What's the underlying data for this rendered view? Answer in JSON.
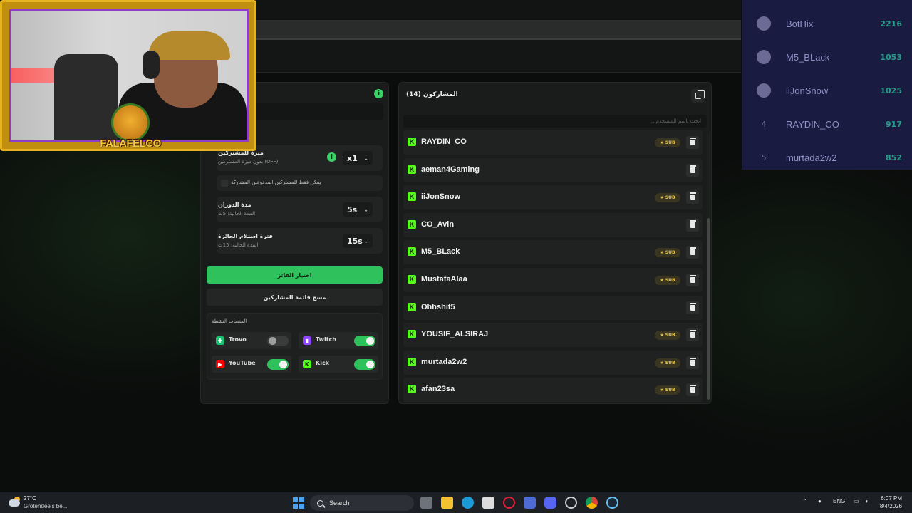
{
  "leaderboard": [
    {
      "rank": "",
      "name": "BotHix",
      "score": "2216",
      "avatar": true
    },
    {
      "rank": "",
      "name": "M5_BLack",
      "score": "1053",
      "avatar": true
    },
    {
      "rank": "",
      "name": "iiJonSnow",
      "score": "1025",
      "avatar": true
    },
    {
      "rank": "4",
      "name": "RAYDIN_CO",
      "score": "917",
      "avatar": false
    },
    {
      "rank": "5",
      "name": "murtada2w2",
      "score": "852",
      "avatar": false
    }
  ],
  "overlay": {
    "logo_text": "FALAFELCO"
  },
  "settings": {
    "viewer_feature_title": "ميزة للمشتركين",
    "viewer_feature_sub": "بدون ميزة المشتركين (OFF)",
    "multiplier": "x1",
    "paid_only_label": "يمكن فقط للمشتركين المدفوعين المشاركة",
    "spin_duration_title": "مدة الدوران",
    "spin_duration_sub": "المدة الحالية: 5ث",
    "spin_duration_value": "5s",
    "claim_period_title": "فترة استلام الجائزة",
    "claim_period_sub": "المدة الحالية: 15ث",
    "claim_period_value": "15s",
    "pick_winner_label": "اختيار الفائز",
    "clear_list_label": "مسح قائمة المشاركين",
    "platforms_title": "المنصات النشطة",
    "platforms": [
      {
        "name": "Trovo",
        "enabled": false,
        "color": "#1dbf73"
      },
      {
        "name": "Twitch",
        "enabled": true,
        "color": "#9146ff"
      },
      {
        "name": "YouTube",
        "enabled": true,
        "color": "#ff0000"
      },
      {
        "name": "Kick",
        "enabled": true,
        "color": "#53fc18"
      }
    ]
  },
  "participants": {
    "title": "المشاركون",
    "count": "(14)",
    "search_placeholder": "ابحث باسم المستخدم...",
    "sub_label": "SUB",
    "rows": [
      {
        "name": "RAYDIN_CO",
        "sub": true
      },
      {
        "name": "aeman4Gaming",
        "sub": false
      },
      {
        "name": "iiJonSnow",
        "sub": true
      },
      {
        "name": "CO_Avin",
        "sub": false
      },
      {
        "name": "M5_BLack",
        "sub": true
      },
      {
        "name": "MustafaAlaa",
        "sub": true
      },
      {
        "name": "Ohhshit5",
        "sub": false
      },
      {
        "name": "YOUSIF_ALSIRAJ",
        "sub": true
      },
      {
        "name": "murtada2w2",
        "sub": true
      },
      {
        "name": "afan23sa",
        "sub": true
      }
    ]
  },
  "taskbar": {
    "temperature": "27°C",
    "weather": "Grotendeels be...",
    "search_label": "Search",
    "lang": "ENG",
    "time": "6:07 PM",
    "date": "8/4/2026"
  }
}
